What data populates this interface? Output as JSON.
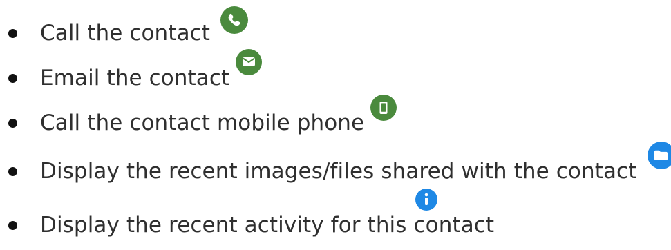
{
  "items": [
    {
      "label": "Call the contact",
      "icon": "phone-icon",
      "icon_color": "#4a8a3d"
    },
    {
      "label": "Email the contact",
      "icon": "email-icon",
      "icon_color": "#4a8a3d"
    },
    {
      "label": "Call the contact mobile phone",
      "icon": "mobile-phone-icon",
      "icon_color": "#4a8a3d"
    },
    {
      "label": "Display the recent images/files shared with the contact",
      "icon": "folder-icon",
      "icon_color": "#1e88e5"
    },
    {
      "label": "Display the recent activity for this contact",
      "icon": "info-icon",
      "icon_color": "#1e88e5"
    }
  ]
}
